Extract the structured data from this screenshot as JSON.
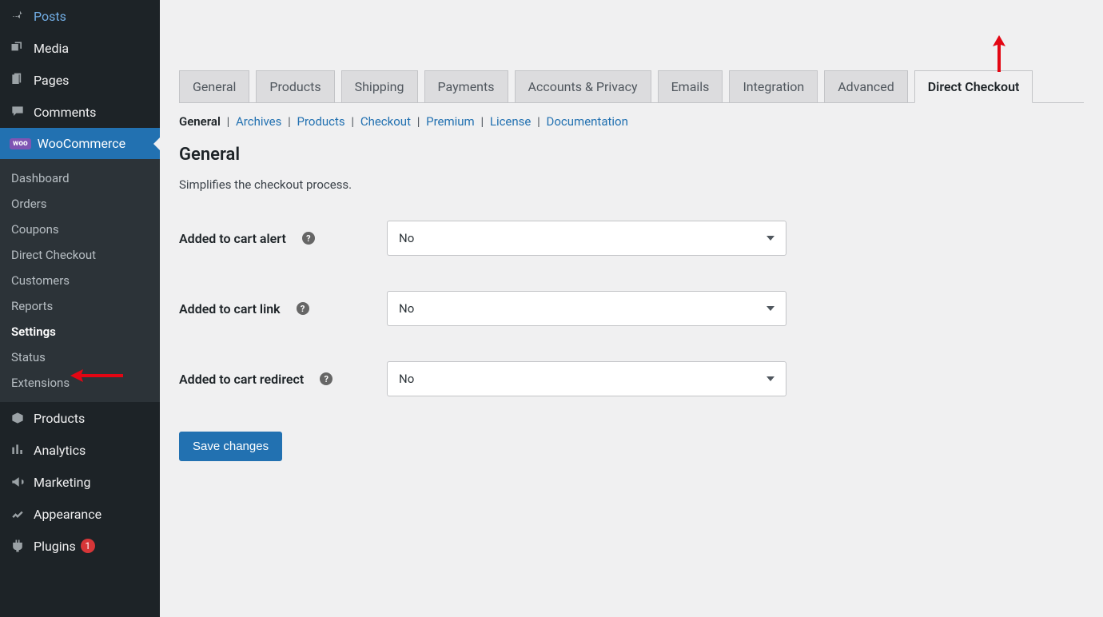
{
  "sidebar": {
    "items": [
      {
        "label": "Posts"
      },
      {
        "label": "Media"
      },
      {
        "label": "Pages"
      },
      {
        "label": "Comments"
      },
      {
        "label": "WooCommerce"
      },
      {
        "label": "Products"
      },
      {
        "label": "Analytics"
      },
      {
        "label": "Marketing"
      },
      {
        "label": "Appearance"
      },
      {
        "label": "Plugins"
      }
    ],
    "plugin_count": "1",
    "submenu": [
      {
        "label": "Dashboard"
      },
      {
        "label": "Orders"
      },
      {
        "label": "Coupons"
      },
      {
        "label": "Direct Checkout"
      },
      {
        "label": "Customers"
      },
      {
        "label": "Reports"
      },
      {
        "label": "Settings"
      },
      {
        "label": "Status"
      },
      {
        "label": "Extensions"
      }
    ]
  },
  "tabs": [
    {
      "label": "General"
    },
    {
      "label": "Products"
    },
    {
      "label": "Shipping"
    },
    {
      "label": "Payments"
    },
    {
      "label": "Accounts & Privacy"
    },
    {
      "label": "Emails"
    },
    {
      "label": "Integration"
    },
    {
      "label": "Advanced"
    },
    {
      "label": "Direct Checkout"
    }
  ],
  "subtabs": [
    {
      "label": "General"
    },
    {
      "label": "Archives"
    },
    {
      "label": "Products"
    },
    {
      "label": "Checkout"
    },
    {
      "label": "Premium"
    },
    {
      "label": "License"
    },
    {
      "label": "Documentation"
    }
  ],
  "section": {
    "title": "General",
    "description": "Simplifies the checkout process."
  },
  "form": {
    "fields": [
      {
        "label": "Added to cart alert",
        "value": "No"
      },
      {
        "label": "Added to cart link",
        "value": "No"
      },
      {
        "label": "Added to cart redirect",
        "value": "No"
      }
    ],
    "save_label": "Save changes"
  }
}
